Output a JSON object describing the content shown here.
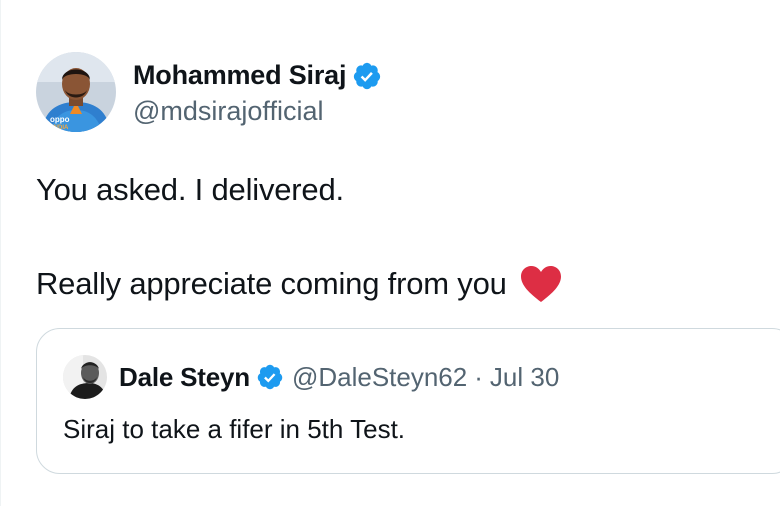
{
  "tweet": {
    "author": {
      "display_name": "Mohammed Siraj",
      "handle": "@mdsirajofficial",
      "verified": true,
      "avatar_jersey_text": "oppo INDIA"
    },
    "text_lines": [
      "You asked. I delivered.",
      "",
      "Really appreciate coming from you"
    ],
    "emoji": "heart"
  },
  "quoted_tweet": {
    "author": {
      "display_name": "Dale Steyn",
      "handle": "@DaleSteyn62",
      "verified": true
    },
    "separator": "·",
    "date": "Jul 30",
    "text": "Siraj to take a fifer in 5th Test."
  },
  "colors": {
    "text_primary": "#0f1419",
    "text_secondary": "#536471",
    "verified_blue": "#1d9bf0",
    "heart_red": "#dd2e44",
    "border": "#cfd9de"
  }
}
